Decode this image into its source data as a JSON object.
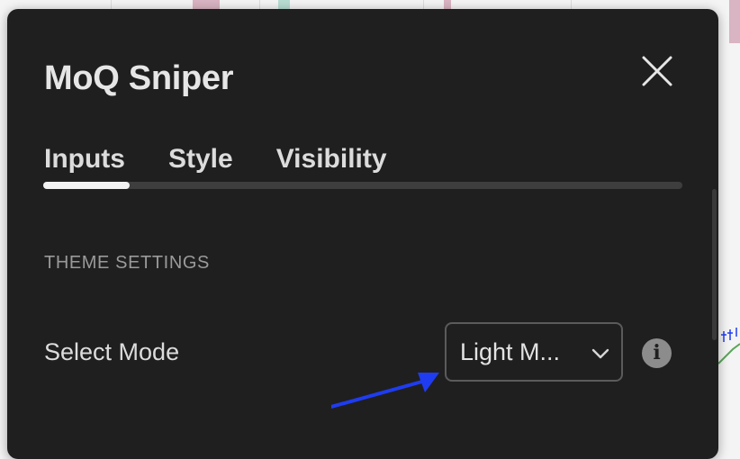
{
  "dialog": {
    "title": "MoQ Sniper",
    "close_icon": "close-icon"
  },
  "tabs": [
    {
      "label": "Inputs",
      "active": true
    },
    {
      "label": "Style",
      "active": false
    },
    {
      "label": "Visibility",
      "active": false
    }
  ],
  "section": {
    "heading": "THEME SETTINGS"
  },
  "fields": {
    "select_mode": {
      "label": "Select Mode",
      "value": "Light M...",
      "dropdown_icon": "chevron-down-icon",
      "info_icon": "info-icon"
    }
  },
  "annotation": {
    "arrow_icon": "arrow-icon",
    "arrow_color": "#1f3cf0"
  },
  "colors": {
    "dialog_bg": "#1f1f1f",
    "text": "#dcdcdc",
    "muted_text": "#9a9a9a",
    "tab_indicator": "#f2f2f2",
    "backdrop_candle_red": "#d9b4c2",
    "backdrop_candle_green": "#b7ddd3",
    "backdrop_line_green": "#5aa55a"
  }
}
